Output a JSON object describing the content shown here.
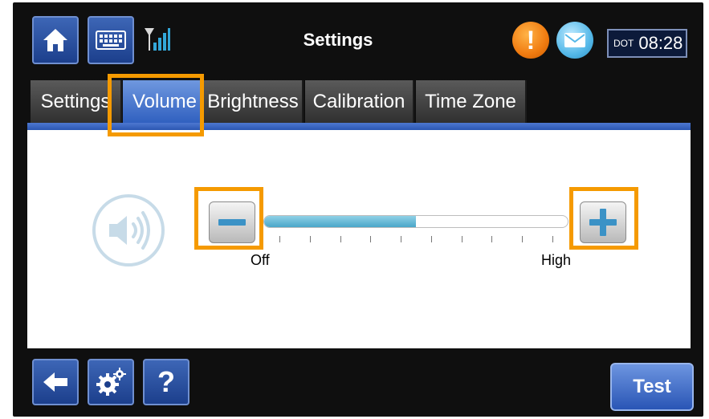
{
  "header": {
    "title": "Settings",
    "clock": {
      "timezone": "DOT",
      "time": "08:28"
    },
    "icons": [
      "home-icon",
      "keyboard-icon",
      "signal-icon",
      "alert-icon",
      "mail-icon"
    ]
  },
  "tabs": [
    {
      "label": "Settings",
      "active": false
    },
    {
      "label": "Volume",
      "active": true
    },
    {
      "label": "Brightness",
      "active": false
    },
    {
      "label": "Calibration",
      "active": false
    },
    {
      "label": "Time Zone",
      "active": false
    }
  ],
  "volume": {
    "min_label": "Off",
    "max_label": "High",
    "level_fraction": 0.5,
    "tick_count": 10
  },
  "footer": {
    "help_label": "?",
    "test_label": "Test",
    "icons": [
      "back-arrow-icon",
      "gear-icon"
    ]
  },
  "colors": {
    "accent_blue": "#2f5fbf",
    "highlight_orange": "#f59a00",
    "slider_fill": "#4aa6c9"
  }
}
